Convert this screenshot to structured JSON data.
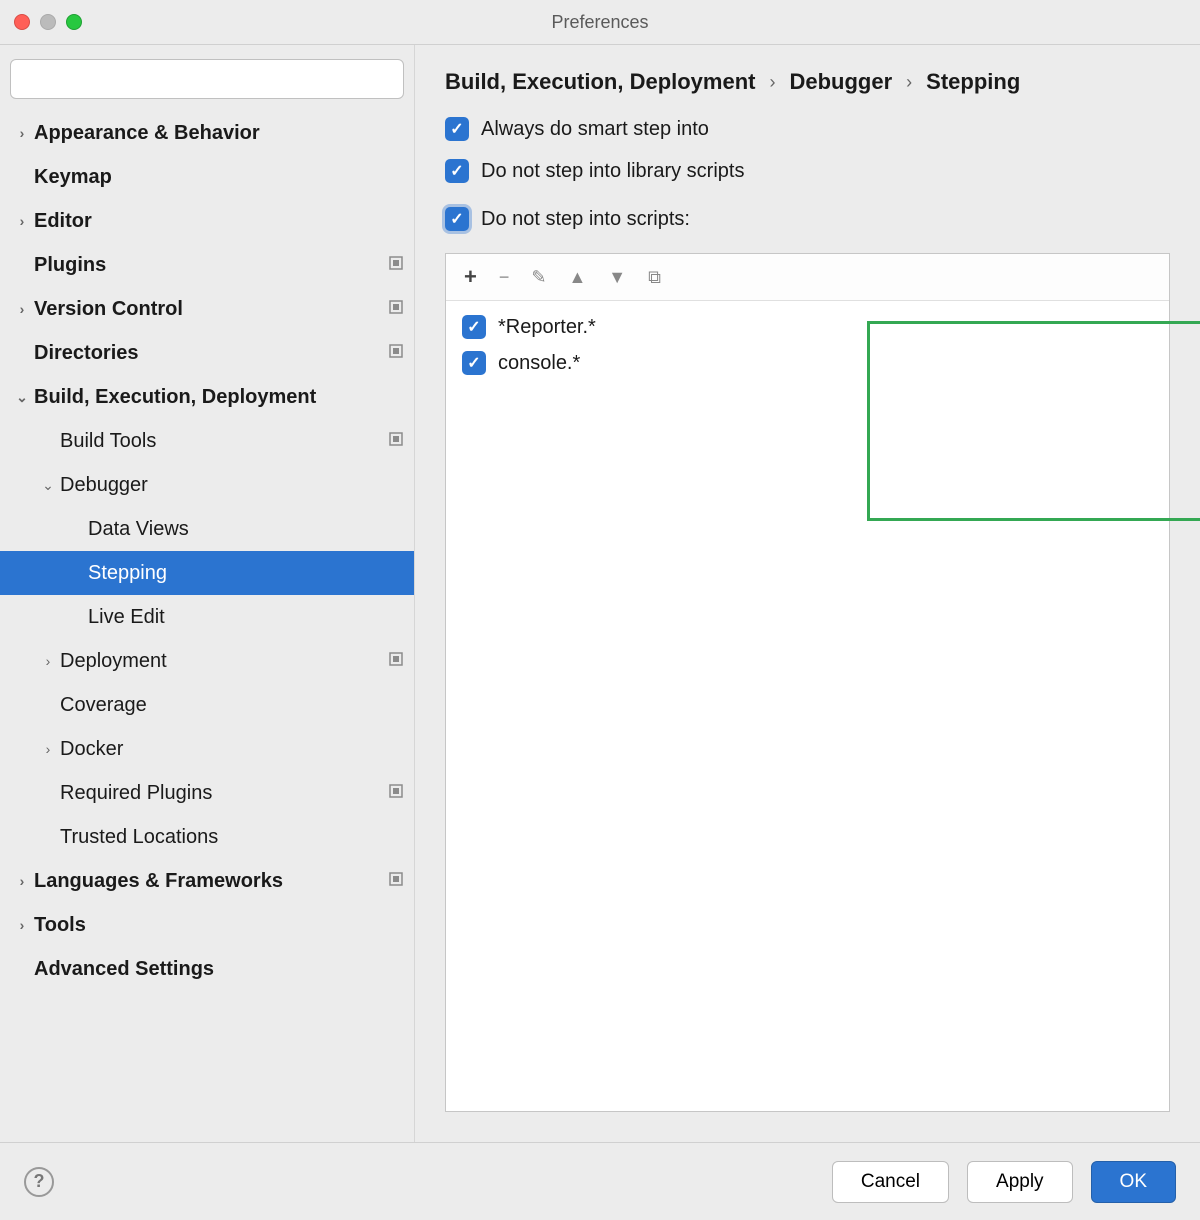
{
  "title": "Preferences",
  "search": {
    "placeholder": ""
  },
  "breadcrumb": {
    "parts": [
      "Build, Execution, Deployment",
      "Debugger",
      "Stepping"
    ]
  },
  "sidebar": {
    "items": [
      {
        "label": "Appearance & Behavior",
        "depth": 0,
        "bold": true,
        "chev": "right",
        "trail": false
      },
      {
        "label": "Keymap",
        "depth": 0,
        "bold": true,
        "chev": "none",
        "trail": false
      },
      {
        "label": "Editor",
        "depth": 0,
        "bold": true,
        "chev": "right",
        "trail": false
      },
      {
        "label": "Plugins",
        "depth": 0,
        "bold": true,
        "chev": "none",
        "trail": true
      },
      {
        "label": "Version Control",
        "depth": 0,
        "bold": true,
        "chev": "right",
        "trail": true
      },
      {
        "label": "Directories",
        "depth": 0,
        "bold": true,
        "chev": "none",
        "trail": true
      },
      {
        "label": "Build, Execution, Deployment",
        "depth": 0,
        "bold": true,
        "chev": "down",
        "trail": false
      },
      {
        "label": "Build Tools",
        "depth": 1,
        "bold": false,
        "chev": "none",
        "trail": true
      },
      {
        "label": "Debugger",
        "depth": 1,
        "bold": false,
        "chev": "down",
        "trail": false
      },
      {
        "label": "Data Views",
        "depth": 2,
        "bold": false,
        "chev": "none",
        "trail": false
      },
      {
        "label": "Stepping",
        "depth": 2,
        "bold": false,
        "chev": "none",
        "trail": false,
        "selected": true
      },
      {
        "label": "Live Edit",
        "depth": 2,
        "bold": false,
        "chev": "none",
        "trail": false
      },
      {
        "label": "Deployment",
        "depth": 1,
        "bold": false,
        "chev": "right",
        "trail": true
      },
      {
        "label": "Coverage",
        "depth": 1,
        "bold": false,
        "chev": "none",
        "trail": false
      },
      {
        "label": "Docker",
        "depth": 1,
        "bold": false,
        "chev": "right",
        "trail": false
      },
      {
        "label": "Required Plugins",
        "depth": 1,
        "bold": false,
        "chev": "none",
        "trail": true
      },
      {
        "label": "Trusted Locations",
        "depth": 1,
        "bold": false,
        "chev": "none",
        "trail": false
      },
      {
        "label": "Languages & Frameworks",
        "depth": 0,
        "bold": true,
        "chev": "right",
        "trail": true
      },
      {
        "label": "Tools",
        "depth": 0,
        "bold": true,
        "chev": "right",
        "trail": false
      },
      {
        "label": "Advanced Settings",
        "depth": 0,
        "bold": true,
        "chev": "none",
        "trail": false
      }
    ]
  },
  "options": {
    "smart_step": "Always do smart step into",
    "no_lib_scripts": "Do not step into library scripts",
    "no_scripts": "Do not step into scripts:"
  },
  "scripts": {
    "items": [
      {
        "label": "*Reporter.*"
      },
      {
        "label": "console.*"
      }
    ],
    "toolbar": {
      "add": "+",
      "remove": "−",
      "edit": "✎",
      "up": "▲",
      "down": "▼",
      "copy": "⧉"
    }
  },
  "footer": {
    "help": "?",
    "cancel": "Cancel",
    "apply": "Apply",
    "ok": "OK"
  }
}
